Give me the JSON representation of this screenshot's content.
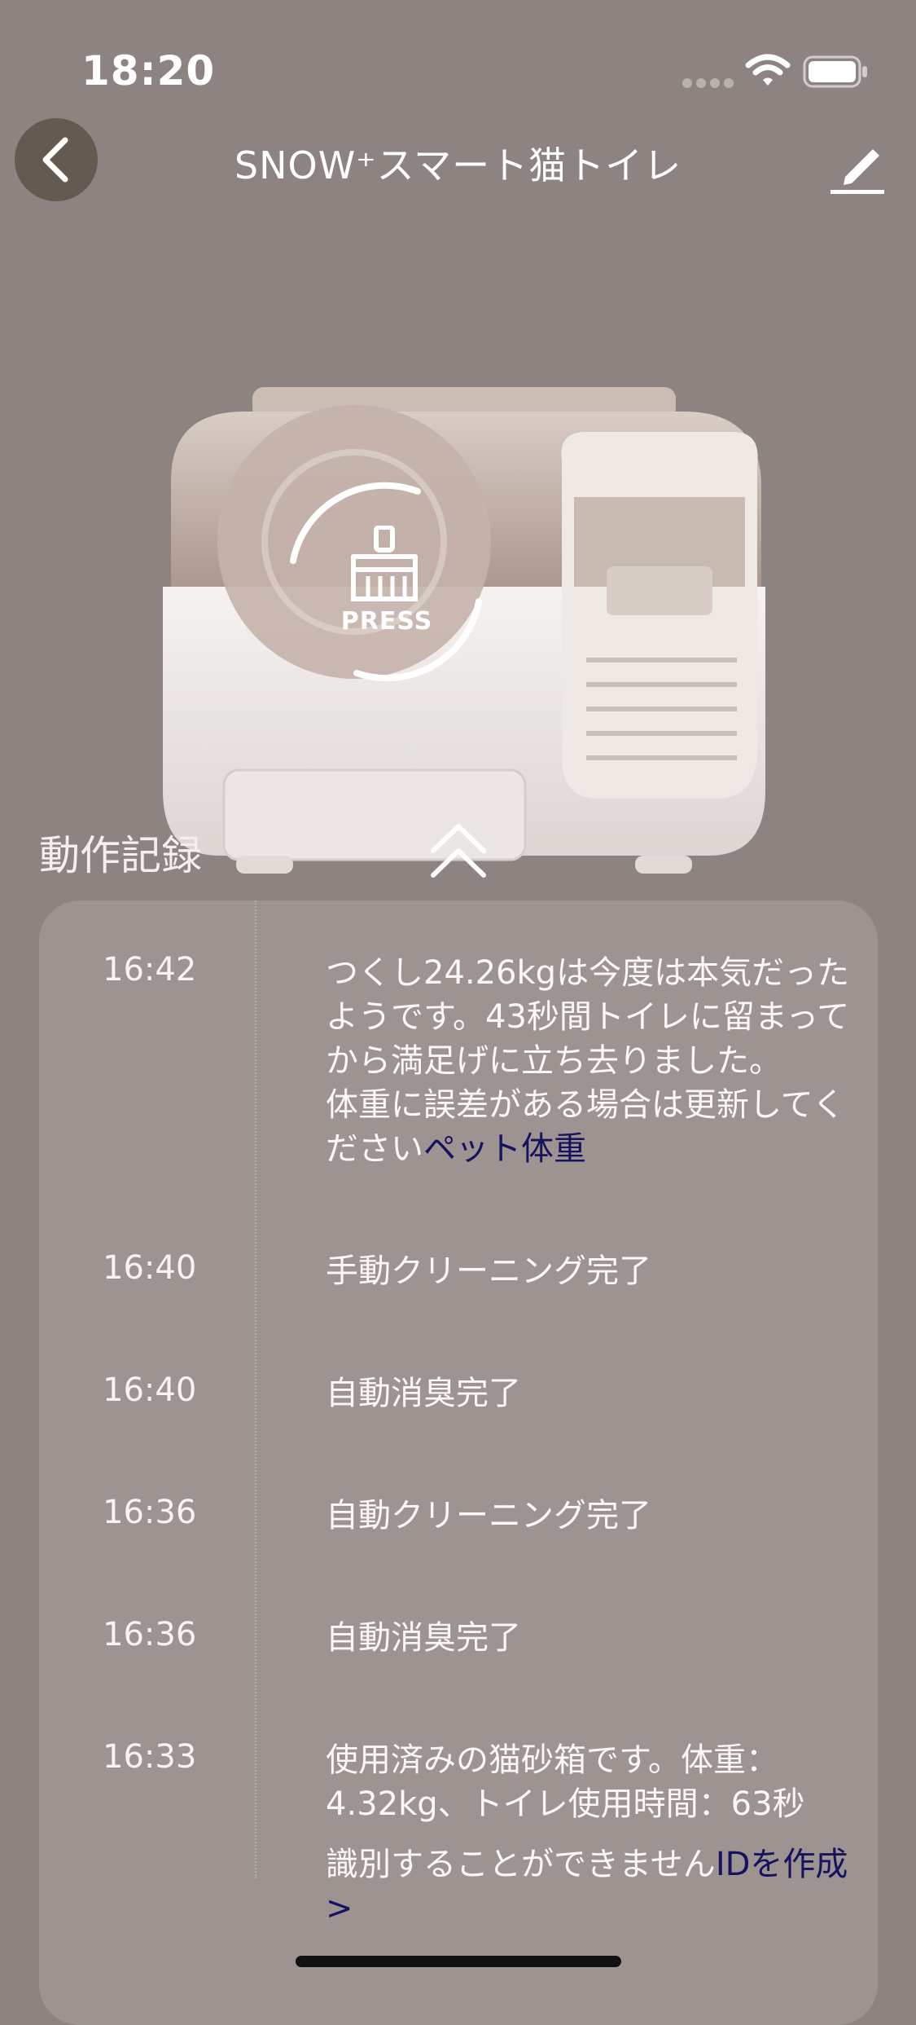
{
  "status_bar": {
    "time": "18:20"
  },
  "nav": {
    "title": "SNOW⁺スマート猫トイレ"
  },
  "device": {
    "press_label": "PRESS"
  },
  "section": {
    "title": "動作記録"
  },
  "logs": [
    {
      "time": "16:42",
      "lines": [
        "つくし24.26kgは今度は本気だったようです。43秒間トイレに留まってから満足げに立ち去りました。",
        "体重に誤差がある場合は更新してください"
      ],
      "link": "ペット体重"
    },
    {
      "time": "16:40",
      "text": "手動クリーニング完了"
    },
    {
      "time": "16:40",
      "text": "自動消臭完了"
    },
    {
      "time": "16:36",
      "text": "自動クリーニング完了"
    },
    {
      "time": "16:36",
      "text": "自動消臭完了"
    },
    {
      "time": "16:33",
      "text": "使用済みの猫砂箱です。体重：4.32kg、トイレ使用時間：63秒",
      "text2": "識別することができません",
      "link": "IDを作成 >"
    }
  ],
  "colors": {
    "background": "#8d8380",
    "panel": "#9d9491",
    "back_button": "#645a52",
    "link": "#16125f"
  },
  "icons": [
    "back-icon",
    "edit-icon",
    "wifi-icon",
    "battery-icon",
    "signal-icon",
    "broom-icon",
    "chevron-up-icon"
  ]
}
